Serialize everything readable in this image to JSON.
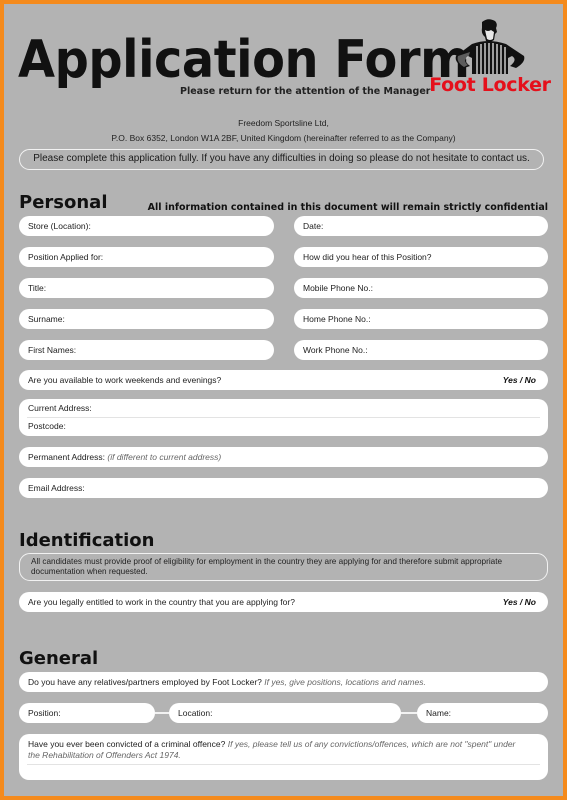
{
  "header": {
    "title": "Application Form",
    "subtitle": "Please return for the attention of the Manager",
    "logo_icon": "foot-locker-referee-logo",
    "logo_text": "Foot Locker",
    "brand_color": "#e5101b"
  },
  "company": {
    "name": "Freedom Sportsline Ltd,",
    "address": "P.O. Box 6352, London W1A 2BF, United Kingdom (hereinafter referred to as the Company)"
  },
  "notice": "Please complete this application fully. If you have any difficulties in doing so please do not hesitate to contact us.",
  "personal": {
    "heading": "Personal",
    "confidential": "All information contained in this document will remain strictly confidential",
    "left_fields": [
      "Store (Location):",
      "Position Applied for:",
      "Title:",
      "Surname:",
      "First Names:"
    ],
    "right_fields": [
      "Date:",
      "How did you hear of this Position?",
      "Mobile Phone No.:",
      "Home Phone No.:",
      "Work Phone No.:"
    ],
    "availability": {
      "label": "Are you available to work weekends and evenings?",
      "options": "Yes / No"
    },
    "current_address": "Current Address:",
    "postcode": "Postcode:",
    "permanent_address": {
      "label": "Permanent Address:",
      "hint": "(if different to current address)"
    },
    "email": "Email Address:"
  },
  "identification": {
    "heading": "Identification",
    "note": "All candidates must provide proof of eligibility for employment in the country they are applying for and therefore submit appropriate documentation when requested.",
    "entitled": {
      "label": "Are you legally entitled to work in the country that you are applying for?",
      "options": "Yes / No"
    }
  },
  "general": {
    "heading": "General",
    "relatives": {
      "label": "Do you have any relatives/partners employed by Foot Locker?",
      "hint": "If yes, give positions, locations and names."
    },
    "position": "Position:",
    "location": "Location:",
    "name": "Name:",
    "criminal": {
      "label": "Have you ever been convicted of a criminal offence?",
      "hint": "If yes, please tell us of any convictions/offences, which are not \"spent\" under the Rehabilitation of Offenders Act 1974."
    }
  }
}
